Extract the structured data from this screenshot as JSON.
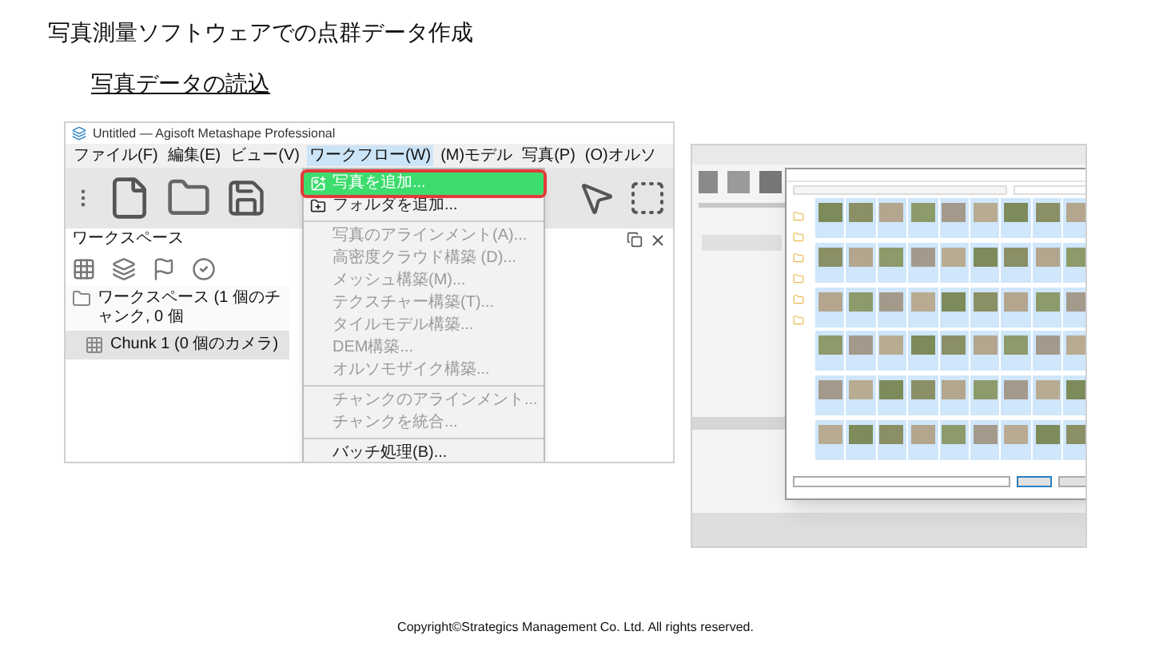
{
  "title": "写真測量ソフトウェアでの点群データ作成",
  "subtitle": "写真データの読込",
  "app_window": {
    "title": "Untitled — Agisoft Metashape Professional",
    "menu": [
      {
        "label": "ファイル(F)",
        "selected": false
      },
      {
        "label": "編集(E)",
        "selected": false
      },
      {
        "label": "ビュー(V)",
        "selected": false
      },
      {
        "label": "ワークフロー(W)",
        "selected": true
      },
      {
        "label": "(M)モデル",
        "selected": false
      },
      {
        "label": "写真(P)",
        "selected": false
      },
      {
        "label": "(O)オルソ",
        "selected": false
      }
    ],
    "workspace": {
      "title": "ワークスペース",
      "tree": [
        {
          "label": "ワークスペース (1 個のチャンク, 0 個",
          "selected": false,
          "children": [
            {
              "label": "Chunk 1 (0 個のカメラ)",
              "selected": true
            }
          ]
        }
      ]
    },
    "dropdown": [
      [
        {
          "label": "写真を追加...",
          "selected": true,
          "disabled": false
        },
        {
          "label": "フォルダを追加...",
          "selected": false,
          "disabled": false
        }
      ],
      [
        {
          "label": "写真のアラインメント(A)...",
          "selected": false,
          "disabled": true
        },
        {
          "label": "高密度クラウド構築 (D)...",
          "selected": false,
          "disabled": true
        },
        {
          "label": "メッシュ構築(M)...",
          "selected": false,
          "disabled": true
        },
        {
          "label": "テクスチャー構築(T)...",
          "selected": false,
          "disabled": true
        },
        {
          "label": "タイルモデル構築...",
          "selected": false,
          "disabled": true
        },
        {
          "label": "DEM構築...",
          "selected": false,
          "disabled": true
        },
        {
          "label": "オルソモザイク構築...",
          "selected": false,
          "disabled": true
        }
      ],
      [
        {
          "label": "チャンクのアラインメント...",
          "selected": false,
          "disabled": true
        },
        {
          "label": "チャンクを統合...",
          "selected": false,
          "disabled": true
        }
      ],
      [
        {
          "label": "バッチ処理(B)...",
          "selected": false,
          "disabled": false
        }
      ]
    ]
  },
  "footer": "Copyright©Strategics Management Co. Ltd. All rights reserved."
}
